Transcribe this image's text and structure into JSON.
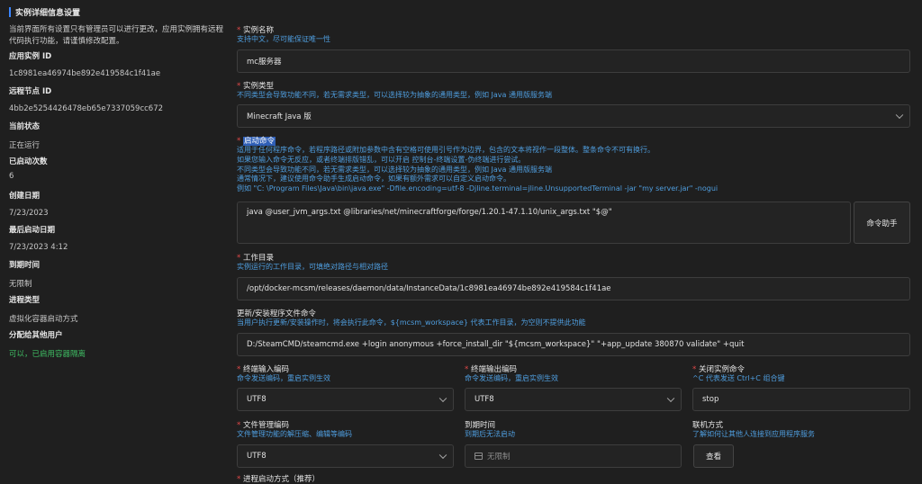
{
  "sidebar": {
    "title": "实例详细信息设置",
    "description": "当前界面所有设置只有管理员可以进行更改，应用实例拥有远程代码执行功能，请谨慎修改配置。",
    "items": [
      {
        "label": "应用实例 ID",
        "value": "1c8981ea46974be892e419584c1f41ae"
      },
      {
        "label": "远程节点 ID",
        "value": "4bb2e5254426478eb65e7337059cc672"
      },
      {
        "label": "当前状态",
        "value": "正在运行"
      },
      {
        "label": "已启动次数",
        "value": "6"
      },
      {
        "label": "创建日期",
        "value": "7/23/2023"
      },
      {
        "label": "最后启动日期",
        "value": "7/23/2023 4:12"
      },
      {
        "label": "到期时间",
        "value": "无限制"
      },
      {
        "label": "进程类型",
        "value": "虚拟化容器启动方式"
      },
      {
        "label": "分配给其他用户",
        "value": "可以，已启用容器隔离"
      }
    ]
  },
  "form": {
    "instance_name": {
      "label": "实例名称",
      "hint": "支持中文，尽可能保证唯一性",
      "value": "mc服务器"
    },
    "instance_type": {
      "label": "实例类型",
      "hint": "不同类型会导致功能不同，若无需求类型，可以选择较为抽象的通用类型，例如 Java 通用版服务端",
      "value": "Minecraft Java 版"
    },
    "start_command": {
      "label": "启动命令",
      "hints": [
        "适用于任何程序命令，若程序路径或附加参数中含有空格可使用引号作为边界，包含的文本将视作一段整体。整条命令不可有换行。",
        "如果您输入命令无反应，或者终端排版错乱，可以开启 控制台-终端设置-伪终端进行尝试。",
        "不同类型会导致功能不同，若无需求类型，可以选择较为抽象的通用类型，例如 Java 通用版服务端",
        "通常情况下，建议使用命令助手生成启动命令，如果有额外需求可以自定义启动命令。",
        "例如 \"C: \\Program Files\\Java\\bin\\java.exe\" -Dfile.encoding=utf-8 -Djline.terminal=jline.UnsupportedTerminal -jar \"my server.jar\" -nogui"
      ],
      "value": "java @user_jvm_args.txt @libraries/net/minecraftforge/forge/1.20.1-47.1.10/unix_args.txt \"$@\"",
      "helper_button": "命令助手"
    },
    "work_dir": {
      "label": "工作目录",
      "hint": "实例运行的工作目录，可填绝对路径与相对路径",
      "value": "/opt/docker-mcsm/releases/daemon/data/InstanceData/1c8981ea46974be892e419584c1f41ae"
    },
    "update_command": {
      "label": "更新/安装程序文件命令",
      "hint": "当用户执行更新/安装操作时，将会执行此命令，${mcsm_workspace} 代表工作目录，为空则不提供此功能",
      "value": "D:/SteamCMD/steamcmd.exe +login anonymous +force_install_dir \"${mcsm_workspace}\" \"+app_update 380870 validate\" +quit"
    },
    "input_encoding": {
      "label": "终端输入编码",
      "hint": "命令发送编码，重启实例生效",
      "value": "UTF8"
    },
    "output_encoding": {
      "label": "终端输出编码",
      "hint": "命令发送编码，重启实例生效",
      "value": "UTF8"
    },
    "stop_command": {
      "label": "关闭实例命令",
      "hint": "^C 代表发送 Ctrl+C 组合键",
      "value": "stop"
    },
    "file_encoding": {
      "label": "文件管理编码",
      "hint": "文件管理功能的解压缩、编辑等编码",
      "value": "UTF8"
    },
    "expire_time": {
      "label": "到期时间",
      "hint": "到期后无法启动",
      "placeholder": "无限制"
    },
    "contact": {
      "label": "联机方式",
      "hint": "了解如何让其他人连接到应用程序服务",
      "button": "查看"
    },
    "process_start": {
      "label": "进程启动方式（推荐）"
    }
  },
  "colors": {
    "accent": "#3a86ff",
    "hint": "#4f9edf",
    "required": "#e04848",
    "ok": "#3fbf64",
    "bg": "#1f1f1f"
  }
}
